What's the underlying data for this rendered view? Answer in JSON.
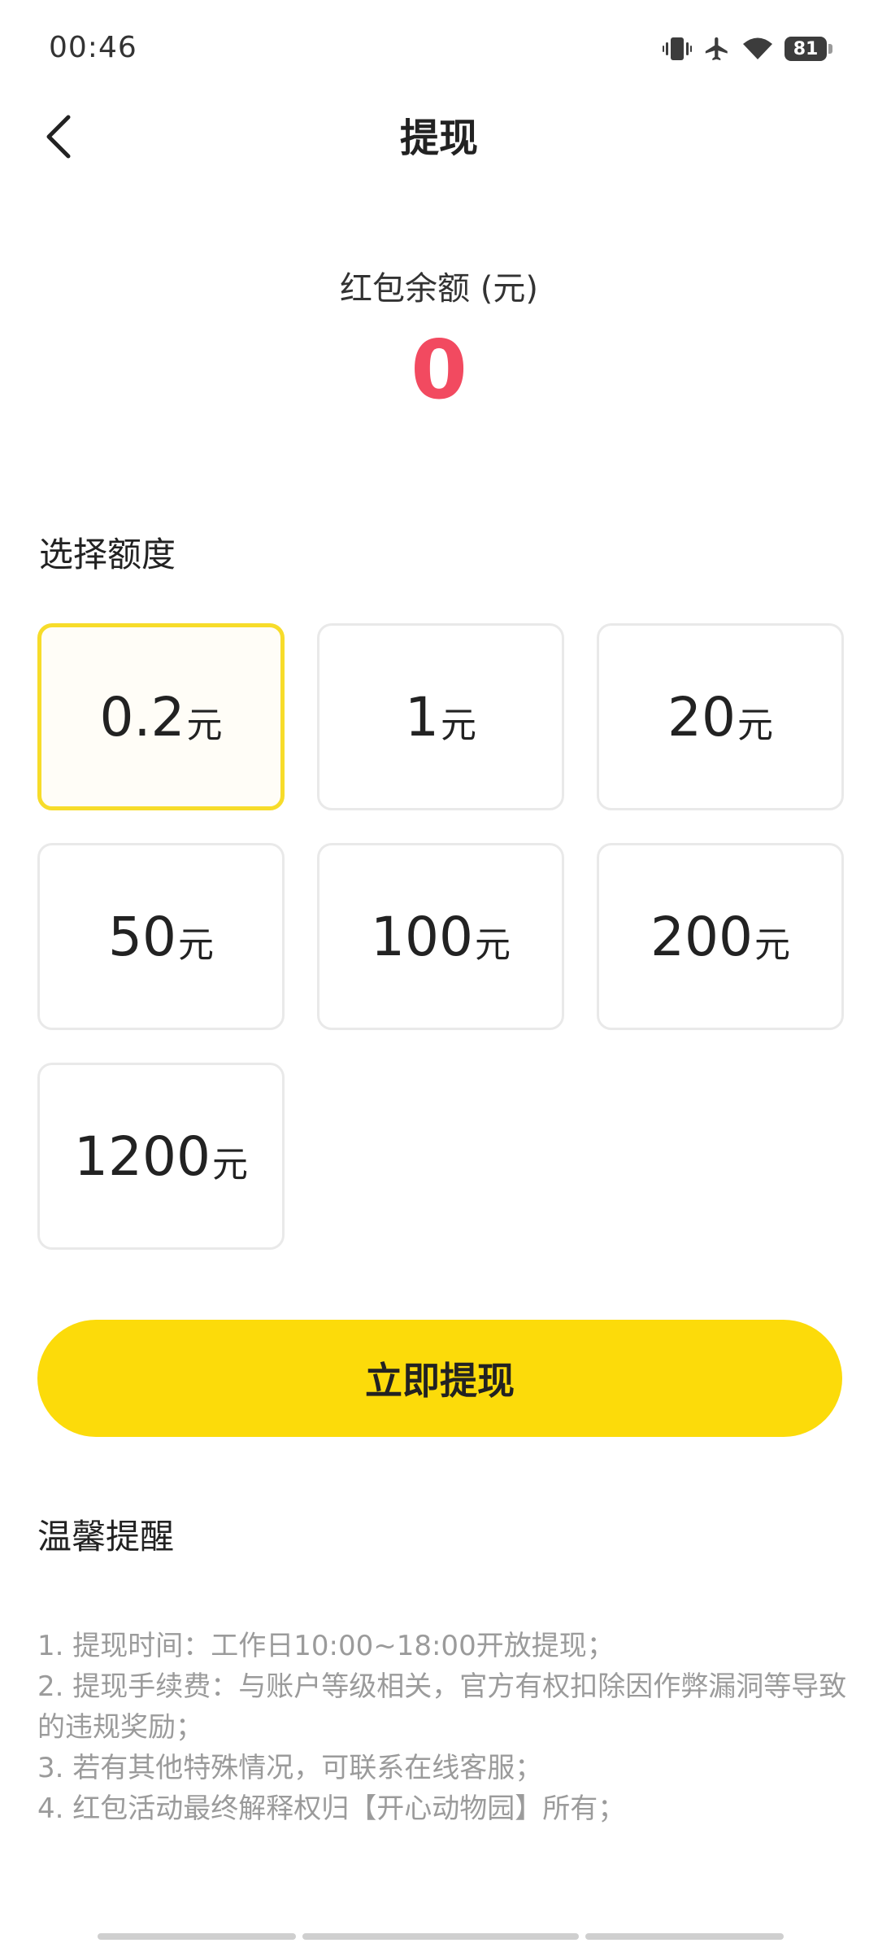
{
  "status_bar": {
    "time": "00:46",
    "battery": "81",
    "icons": [
      "vibrate-icon",
      "airplane-icon",
      "wifi-icon",
      "battery-icon"
    ]
  },
  "header": {
    "title": "提现",
    "back_icon": "chevron-left-icon"
  },
  "balance": {
    "label": "红包余额 (元)",
    "value": "0",
    "value_color": "#f24a60"
  },
  "amount_section": {
    "title": "选择额度",
    "unit": "元",
    "options": [
      {
        "value": "0.2",
        "unit": "元",
        "selected": true
      },
      {
        "value": "1",
        "unit": "元",
        "selected": false
      },
      {
        "value": "20",
        "unit": "元",
        "selected": false
      },
      {
        "value": "50",
        "unit": "元",
        "selected": false
      },
      {
        "value": "100",
        "unit": "元",
        "selected": false
      },
      {
        "value": "200",
        "unit": "元",
        "selected": false
      },
      {
        "value": "1200",
        "unit": "元",
        "selected": false
      }
    ]
  },
  "withdraw_button": {
    "label": "立即提现",
    "color": "#fcdb0a"
  },
  "tips": {
    "title": "温馨提醒",
    "items": [
      "1. 提现时间：工作日10:00~18:00开放提现；",
      "2. 提现手续费：与账户等级相关，官方有权扣除因作弊漏洞等导致的违规奖励；",
      "3. 若有其他特殊情况，可联系在线客服；",
      "4. 红包活动最终解释权归【开心动物园】所有；"
    ]
  },
  "colors": {
    "accent": "#fcdb0a",
    "selected_border": "#f7dc2a",
    "balance": "#f24a60",
    "tip_text": "#9b9b9b"
  }
}
